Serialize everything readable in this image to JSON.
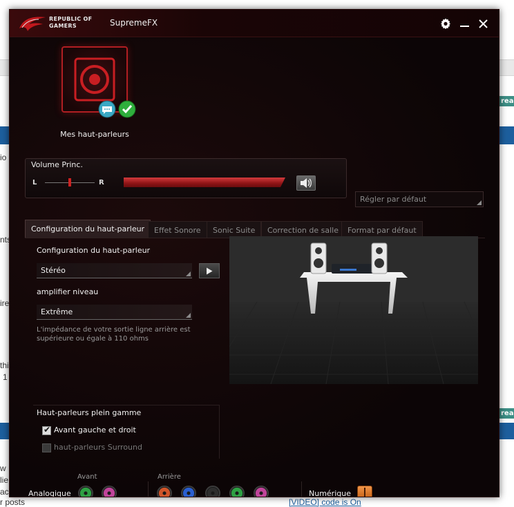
{
  "background": {
    "fragments": [
      "io",
      "nts",
      "ire",
      "thi",
      "1",
      "w",
      "lie",
      "ac",
      "r posts"
    ],
    "teal_badges": [
      "read",
      "read"
    ],
    "link_text": "[VIDEO] code is On"
  },
  "window": {
    "brand_line1": "REPUBLIC OF",
    "brand_line2": "GAMERS",
    "title": "SupremeFX",
    "settings_icon": "gear-icon",
    "minimize_icon": "minimize-icon",
    "close_icon": "close-icon"
  },
  "device": {
    "label": "Mes haut-parleurs",
    "icon": "speaker-icon",
    "badges": [
      "chat-bubble-icon",
      "checkmark-icon"
    ]
  },
  "volume": {
    "title": "Volume Princ.",
    "left_label": "L",
    "right_label": "R",
    "balance": 0.5,
    "level": 0.99,
    "mute_icon": "speaker-volume-icon"
  },
  "default_field": {
    "placeholder": "Régler par défaut"
  },
  "tabs": [
    {
      "label": "Configuration du haut-parleur",
      "active": true
    },
    {
      "label": "Effet Sonore",
      "active": false
    },
    {
      "label": "Sonic Suite",
      "active": false
    },
    {
      "label": "Correction de salle",
      "active": false
    },
    {
      "label": "Format par défaut",
      "active": false
    }
  ],
  "config": {
    "speaker_config_label": "Configuration du haut-parleur",
    "speaker_config_value": "Stéréo",
    "amp_label": "amplifier niveau",
    "amp_value": "Extrême",
    "note": "L'impédance de votre sortie ligne arrière est supérieure ou égale à 110 ohms",
    "fullrange_title": "Haut-parleurs plein gamme",
    "front_lr_label": "Avant gauche et droit",
    "front_lr_checked": true,
    "surround_label": "haut-parleurs Surround",
    "surround_checked": false
  },
  "jacks": {
    "analog_label": "Analogique",
    "front_label": "Avant",
    "rear_label": "Arrière",
    "digital_label": "Numérique",
    "front_colors": [
      "#2ea043",
      "#c0449a"
    ],
    "rear_colors": [
      "#d0552a",
      "#2a5fd0",
      "#2e2e2e",
      "#2ea043",
      "#c0449a"
    ]
  }
}
